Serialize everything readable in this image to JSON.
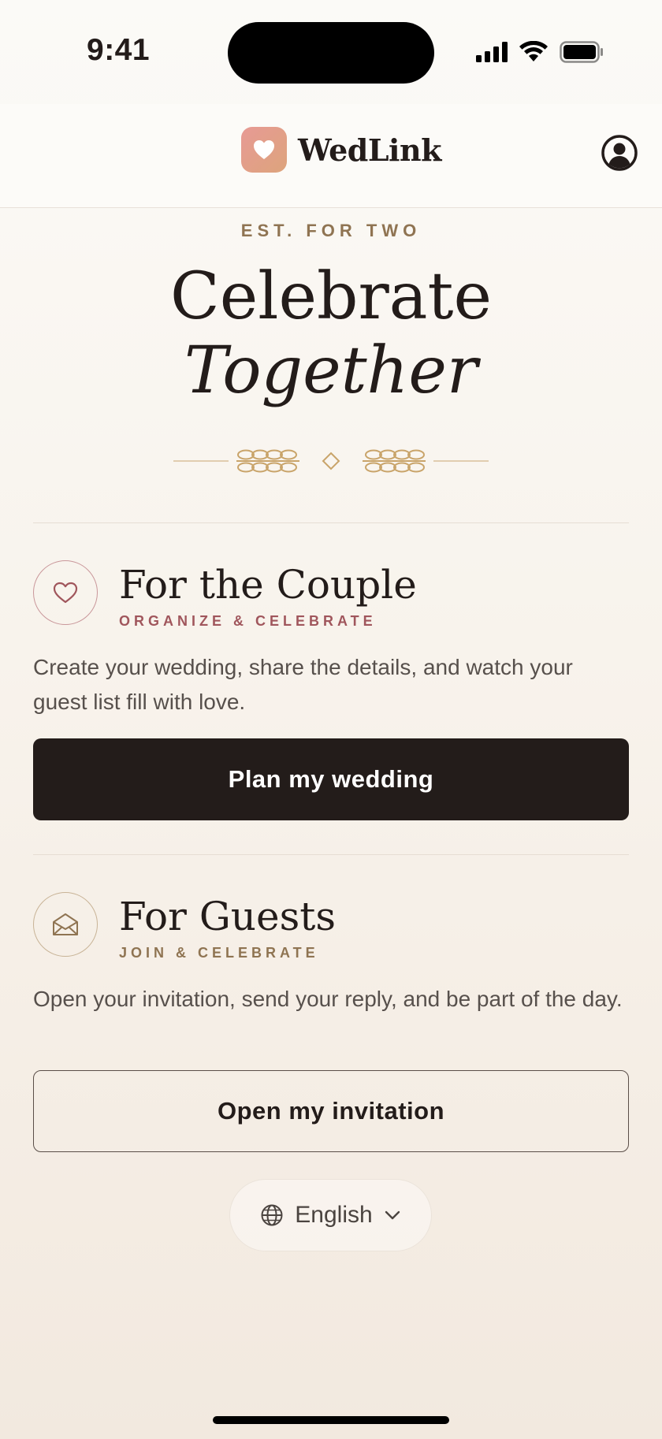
{
  "status_bar": {
    "time": "9:41"
  },
  "header": {
    "brand_name": "WedLink",
    "brand_icon": "heart-icon",
    "account_icon": "user-circle-icon"
  },
  "hero": {
    "eyebrow": "EST. FOR TWO",
    "title_line1": "Celebrate",
    "title_line2": "Together"
  },
  "couple": {
    "icon": "heart-outline-icon",
    "title": "For the Couple",
    "subtitle": "ORGANIZE & CELEBRATE",
    "description": "Create your wedding, share the details, and watch your guest list fill with love.",
    "button_label": "Plan my wedding"
  },
  "guests": {
    "icon": "envelope-open-icon",
    "title": "For Guests",
    "subtitle": "JOIN & CELEBRATE",
    "description": "Open your invitation, send your reply, and be part of the day.",
    "button_label": "Open my invitation"
  },
  "language": {
    "label": "English",
    "icon": "globe-icon",
    "chevron": "chevron-down-icon"
  },
  "colors": {
    "ink": "#231c1a",
    "gold": "#8f7452",
    "rose": "#a0565c",
    "brand_gradient_start": "#e79a95",
    "brand_gradient_end": "#dda47c"
  }
}
